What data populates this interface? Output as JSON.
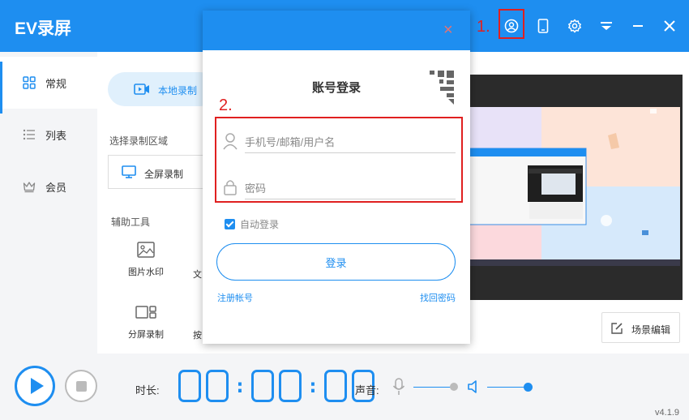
{
  "app": {
    "title": "EV录屏",
    "version": "v4.1.9"
  },
  "annotations": {
    "step1": "1.",
    "step2": "2."
  },
  "sidebar": {
    "items": [
      {
        "label": "常规",
        "icon": "grid-icon"
      },
      {
        "label": "列表",
        "icon": "list-icon"
      },
      {
        "label": "会员",
        "icon": "crown-icon"
      }
    ]
  },
  "main": {
    "tab_label": "本地录制",
    "area_label": "选择录制区域",
    "fullscreen_label": "全屏录制",
    "tools_label": "辅助工具",
    "tools": [
      {
        "label": "图片水印",
        "icon": "image-icon"
      },
      {
        "label": "分屏录制",
        "icon": "split-screen-icon"
      }
    ],
    "clipped_text": [
      "文",
      "按"
    ]
  },
  "scene_edit_label": "场景编辑",
  "bottom": {
    "duration_label": "时长:",
    "timer": "00:00:00",
    "sound_label": "声音:"
  },
  "dialog": {
    "title": "账号登录",
    "username_placeholder": "手机号/邮箱/用户名",
    "password_placeholder": "密码",
    "auto_login_label": "自动登录",
    "auto_login_checked": true,
    "login_label": "登录",
    "register_label": "注册帐号",
    "forgot_label": "找回密码",
    "close_symbol": "×"
  },
  "colors": {
    "accent": "#1e8ef0",
    "annotation": "#e02020"
  }
}
